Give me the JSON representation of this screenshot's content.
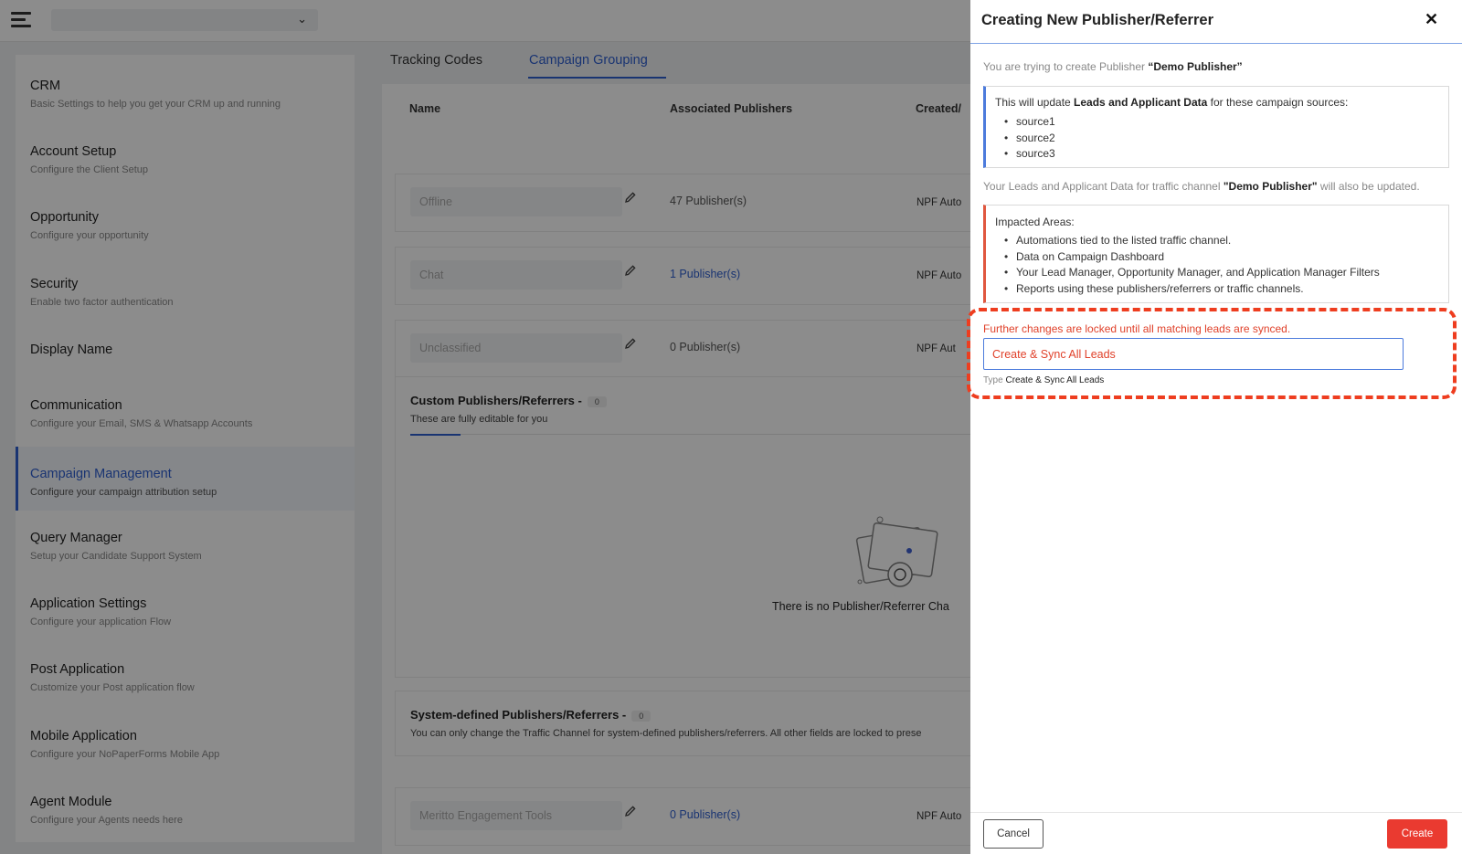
{
  "topbar": {
    "selector_value": ""
  },
  "sidebar": {
    "items": [
      {
        "title": "CRM",
        "subtitle": "Basic Settings to help you get your CRM up and running"
      },
      {
        "title": "Account Setup",
        "subtitle": "Configure the Client Setup"
      },
      {
        "title": "Opportunity",
        "subtitle": "Configure your opportunity"
      },
      {
        "title": "Security",
        "subtitle": "Enable two factor authentication"
      },
      {
        "title": "Display Name",
        "subtitle": ""
      },
      {
        "title": "Communication",
        "subtitle": "Configure your Email, SMS & Whatsapp Accounts"
      },
      {
        "title": "Campaign Management",
        "subtitle": "Configure your campaign attribution setup"
      },
      {
        "title": "Query Manager",
        "subtitle": "Setup your Candidate Support System"
      },
      {
        "title": "Application Settings",
        "subtitle": "Configure your application Flow"
      },
      {
        "title": "Post Application",
        "subtitle": "Customize your Post application flow"
      },
      {
        "title": "Mobile Application",
        "subtitle": "Configure your NoPaperForms Mobile App"
      },
      {
        "title": "Agent Module",
        "subtitle": "Configure your Agents needs here"
      }
    ]
  },
  "main": {
    "tabs": [
      {
        "label": "Tracking Codes"
      },
      {
        "label": "Campaign Grouping"
      }
    ],
    "columns": {
      "name": "Name",
      "publishers": "Associated Publishers",
      "created": "Created/"
    },
    "rows": [
      {
        "name": "Offline",
        "publishers": "47 Publisher(s)",
        "created": "NPF Auto"
      },
      {
        "name": "Chat",
        "publishers": "1 Publisher(s)",
        "created": "NPF Auto"
      },
      {
        "name": "Unclassified",
        "publishers": "0 Publisher(s)",
        "created": "NPF Aut"
      }
    ],
    "custom_group": {
      "title": "Custom Publishers/Referrers -",
      "count": "0",
      "subtitle": "These are fully editable for you",
      "empty_text": "There is no Publisher/Referrer Cha"
    },
    "system_group": {
      "title": "System-defined Publishers/Referrers -",
      "count": "0",
      "subtitle": "You can only change the Traffic Channel for system-defined publishers/referrers. All other fields are locked to prese"
    },
    "last_row": {
      "name": "Meritto Engagement Tools",
      "publishers": "0 Publisher(s)",
      "created": "NPF Auto"
    }
  },
  "drawer": {
    "title": "Creating New Publisher/Referrer",
    "close_icon": "✕",
    "intro_prefix": "You are trying to create Publisher ",
    "intro_name": "“Demo Publisher”",
    "update_box": {
      "prefix": "This will update ",
      "bold": "Leads and Applicant Data",
      "suffix": " for these campaign sources:",
      "sources": [
        "source1",
        "source2",
        "source3"
      ]
    },
    "note_prefix": "Your Leads and Applicant Data for traffic channel ",
    "note_name": "\"Demo Publisher\"",
    "note_suffix": " will also be updated.",
    "impact_box": {
      "title": "Impacted Areas:",
      "items": [
        "Automations tied to the listed traffic channel.",
        "Data on Campaign Dashboard",
        "Your Lead Manager, Opportunity Manager, and Application Manager Filters",
        "Reports using these publishers/referrers or traffic channels."
      ]
    },
    "lock_message": "Further changes are locked until all matching leads are synced.",
    "confirm_input_value": "Create & Sync All Leads",
    "confirm_hint_prefix": "Type ",
    "confirm_hint_value": "Create & Sync All Leads",
    "cancel_label": "Cancel",
    "create_label": "Create"
  },
  "colors": {
    "accent": "#2f5fd0",
    "danger": "#ea3a30",
    "dashed_highlight": "#ee3d1f"
  }
}
